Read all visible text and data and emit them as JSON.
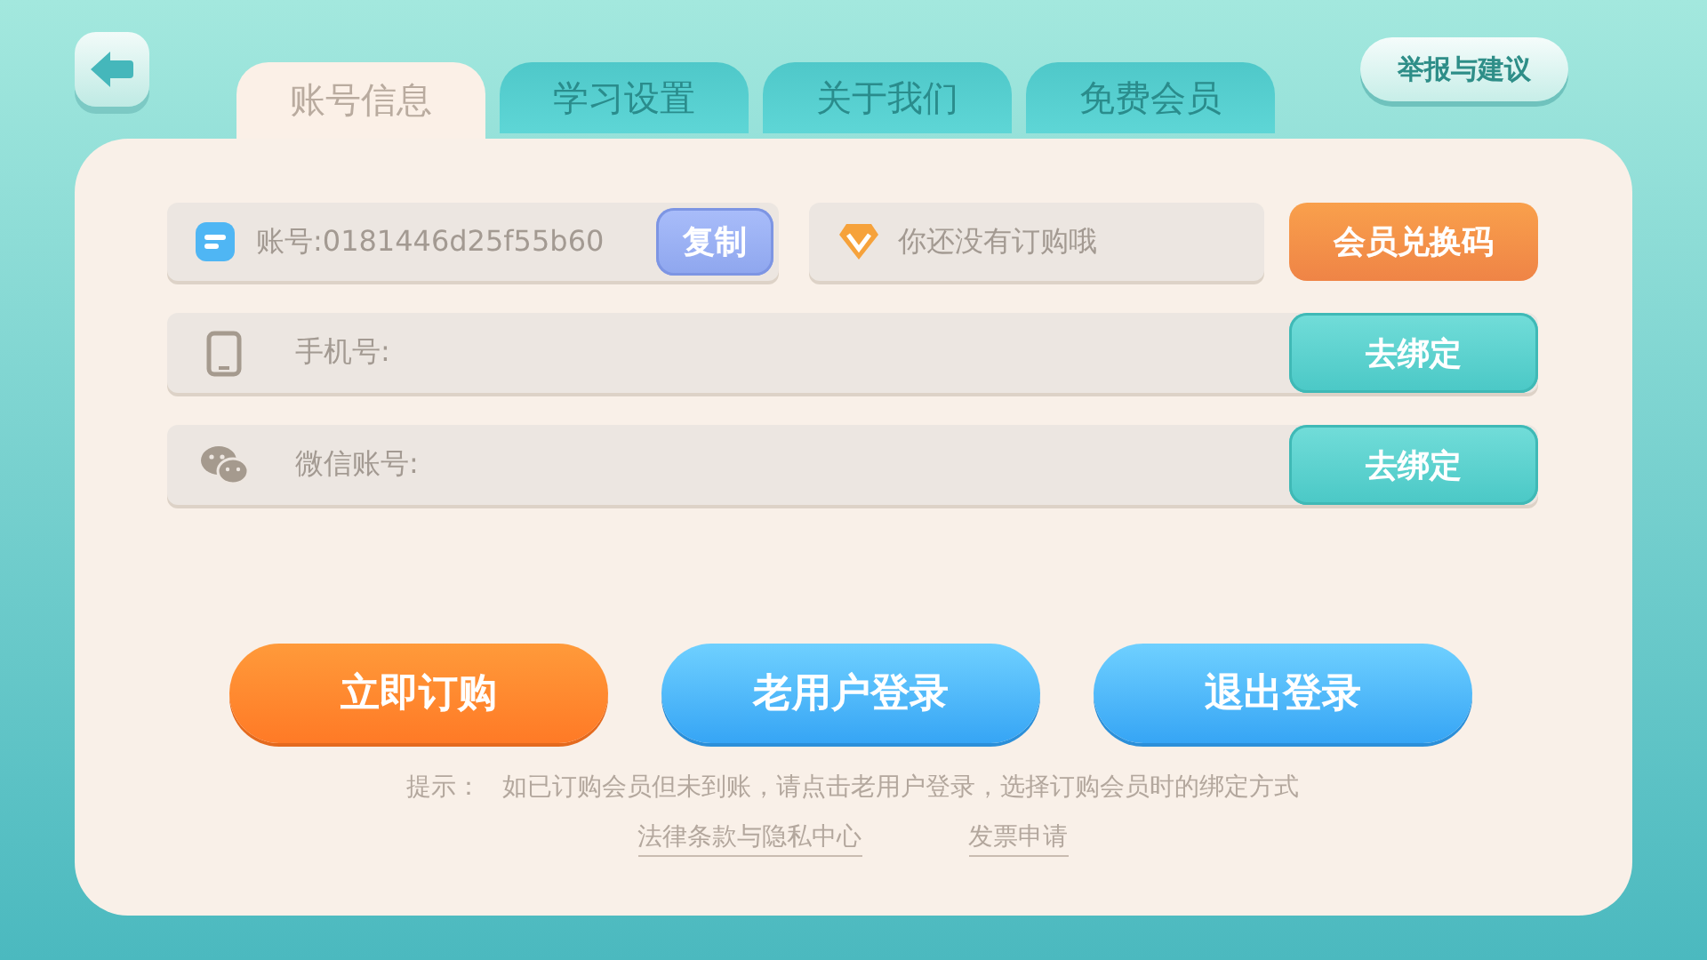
{
  "tabs": [
    {
      "label": "账号信息",
      "selected": true
    },
    {
      "label": "学习设置",
      "selected": false
    },
    {
      "label": "关于我们",
      "selected": false
    },
    {
      "label": "免费会员",
      "selected": false
    }
  ],
  "report_button": "举报与建议",
  "account": {
    "label": "账号:0181446d25f55b60",
    "copy_button": "复制"
  },
  "subscription": {
    "status": "你还没有订购哦"
  },
  "redeem_button": "会员兑换码",
  "bindings": [
    {
      "kind": "phone",
      "label": "手机号:",
      "button": "去绑定"
    },
    {
      "kind": "wechat",
      "label": "微信账号:",
      "button": "去绑定"
    }
  ],
  "actions": [
    {
      "kind": "primary",
      "label": "立即订购"
    },
    {
      "kind": "secondary",
      "label": "老用户登录"
    },
    {
      "kind": "secondary",
      "label": "退出登录"
    }
  ],
  "hint": {
    "label": "提示：",
    "text": "如已订购会员但未到账，请点击老用户登录，选择订购会员时的绑定方式"
  },
  "links": [
    "法律条款与隐私中心",
    "发票申请"
  ]
}
